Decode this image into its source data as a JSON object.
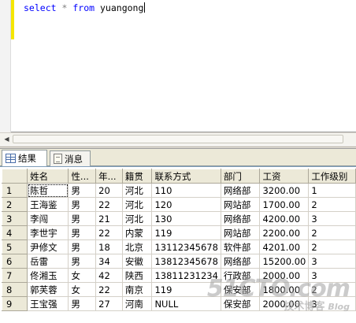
{
  "editor": {
    "keyword_select": "select",
    "star": "*",
    "keyword_from": "from",
    "table_name": "yuangong"
  },
  "tabs": {
    "results_label": "结果",
    "messages_label": "消息"
  },
  "grid": {
    "columns": [
      "姓名",
      "性...",
      "年...",
      "籍贯",
      "联系方式",
      "部门",
      "工资",
      "工作级别"
    ],
    "rows": [
      {
        "n": "1",
        "cells": [
          "陈哲",
          "男",
          "20",
          "河北",
          "110",
          "网络部",
          "3200.00",
          "1"
        ]
      },
      {
        "n": "2",
        "cells": [
          "王海鉴",
          "男",
          "22",
          "河北",
          "120",
          "网站部",
          "1700.00",
          "2"
        ]
      },
      {
        "n": "3",
        "cells": [
          "李闯",
          "男",
          "21",
          "河北",
          "130",
          "网络部",
          "4200.00",
          "3"
        ]
      },
      {
        "n": "4",
        "cells": [
          "李世宇",
          "男",
          "22",
          "内蒙",
          "119",
          "网站部",
          "2200.00",
          "2"
        ]
      },
      {
        "n": "5",
        "cells": [
          "尹修文",
          "男",
          "18",
          "北京",
          "13112345678",
          "软件部",
          "4201.00",
          "2"
        ]
      },
      {
        "n": "6",
        "cells": [
          "岳雷",
          "男",
          "34",
          "安徽",
          "13812345678",
          "网络部",
          "15200.00",
          "3"
        ]
      },
      {
        "n": "7",
        "cells": [
          "佟湘玉",
          "女",
          "42",
          "陕西",
          "13811231234",
          "行政部",
          "2000.00",
          "3"
        ]
      },
      {
        "n": "8",
        "cells": [
          "郭芙蓉",
          "女",
          "22",
          "南京",
          "119",
          "保安部",
          "1800.00",
          "2"
        ]
      },
      {
        "n": "9",
        "cells": [
          "王宝强",
          "男",
          "27",
          "河南",
          "NULL",
          "保安部",
          "2000.00",
          "3"
        ]
      }
    ]
  },
  "watermark": {
    "logo": "51CTO.com",
    "subtitle": "技术博客",
    "blog": "Blog"
  }
}
